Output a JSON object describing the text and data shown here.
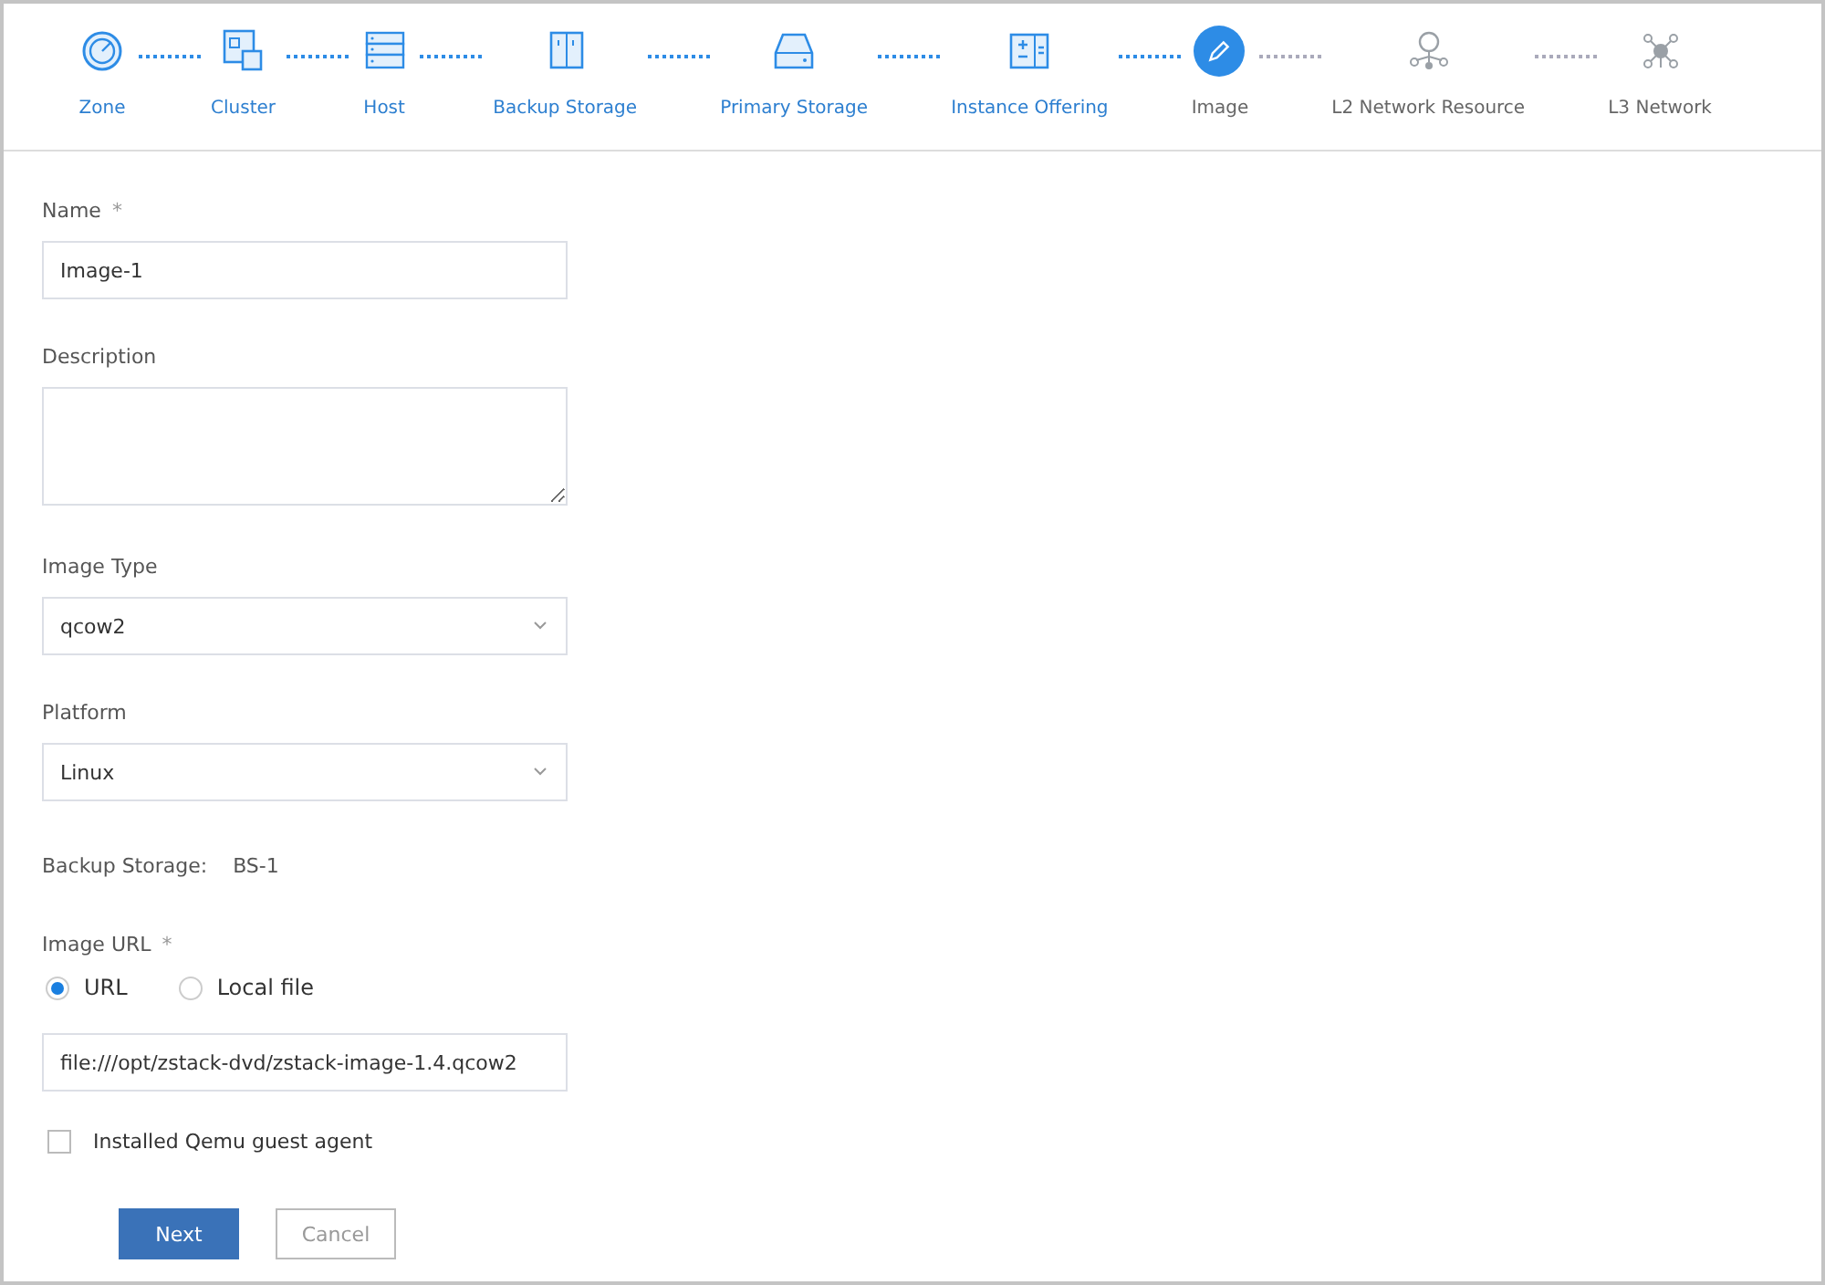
{
  "steps": [
    {
      "kind": "zone",
      "label": "Zone",
      "completed": true,
      "selected": false
    },
    {
      "kind": "cluster",
      "label": "Cluster",
      "completed": true,
      "selected": false
    },
    {
      "kind": "host",
      "label": "Host",
      "completed": true,
      "selected": false
    },
    {
      "kind": "backup",
      "label": "Backup Storage",
      "completed": true,
      "selected": false
    },
    {
      "kind": "primary",
      "label": "Primary Storage",
      "completed": true,
      "selected": false
    },
    {
      "kind": "offering",
      "label": "Instance Offering",
      "completed": true,
      "selected": false
    },
    {
      "kind": "image",
      "label": "Image",
      "completed": false,
      "selected": true
    },
    {
      "kind": "l2",
      "label": "L2 Network Resource",
      "completed": false,
      "selected": false
    },
    {
      "kind": "l3",
      "label": "L3 Network",
      "completed": false,
      "selected": false
    }
  ],
  "form": {
    "name": {
      "label": "Name",
      "required_mark": "*",
      "value": "Image-1"
    },
    "description": {
      "label": "Description"
    },
    "image_type": {
      "label": "Image Type",
      "value": "qcow2"
    },
    "platform": {
      "label": "Platform",
      "value": "Linux"
    },
    "backup_storage": {
      "label": "Backup Storage:",
      "value": "BS-1"
    },
    "image_url": {
      "label": "Image URL",
      "required_mark": "*",
      "options": [
        {
          "label": "URL",
          "selected": true
        },
        {
          "label": "Local file",
          "selected": false
        }
      ],
      "value": "file:///opt/zstack-dvd/zstack-image-1.4.qcow2"
    },
    "guest_agent": {
      "label": "Installed Qemu guest agent",
      "checked": false
    }
  },
  "buttons": [
    {
      "label": "Next",
      "kind": "primary"
    },
    {
      "label": "Cancel",
      "kind": "secondary"
    }
  ]
}
